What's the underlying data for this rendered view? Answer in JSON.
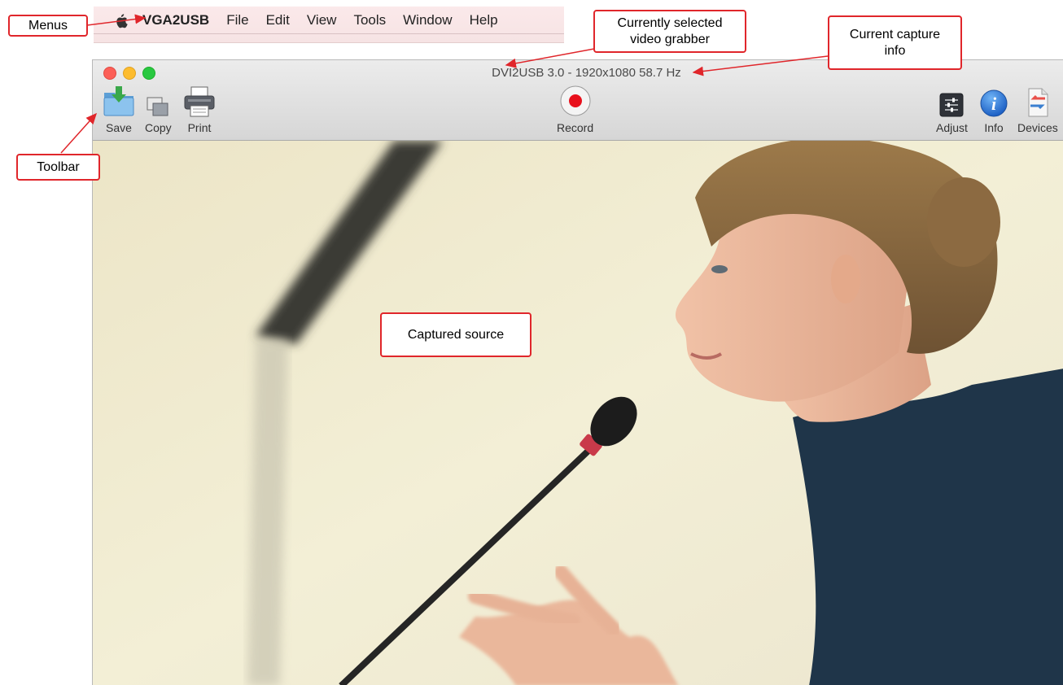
{
  "menubar": {
    "apple_icon": "apple-logo-icon",
    "items": [
      {
        "label": "VGA2USB"
      },
      {
        "label": "File"
      },
      {
        "label": "Edit"
      },
      {
        "label": "View"
      },
      {
        "label": "Tools"
      },
      {
        "label": "Window"
      },
      {
        "label": "Help"
      }
    ]
  },
  "window": {
    "title": "DVI2USB 3.0 - 1920x1080 58.7 Hz",
    "traffic_colors": {
      "close": "#fc5f57",
      "minimize": "#fdbc2e",
      "maximize": "#28c840"
    }
  },
  "toolbar": {
    "save": {
      "label": "Save",
      "icon": "save-folder-icon"
    },
    "copy": {
      "label": "Copy",
      "icon": "copy-icon"
    },
    "print": {
      "label": "Print",
      "icon": "printer-icon"
    },
    "record": {
      "label": "Record",
      "icon": "record-icon"
    },
    "adjust": {
      "label": "Adjust",
      "icon": "sliders-icon"
    },
    "info": {
      "label": "Info",
      "icon": "info-icon"
    },
    "devices": {
      "label": "Devices",
      "icon": "devices-icon"
    }
  },
  "callouts": {
    "menus": "Menus",
    "toolbar": "Toolbar",
    "selected_grabber_line1": "Currently selected",
    "selected_grabber_line2": "video grabber",
    "capture_info_line1": "Current capture",
    "capture_info_line2": "info",
    "captured_source": "Captured source"
  },
  "colors": {
    "callout_border": "#e0262b",
    "record_red": "#e8101c"
  }
}
